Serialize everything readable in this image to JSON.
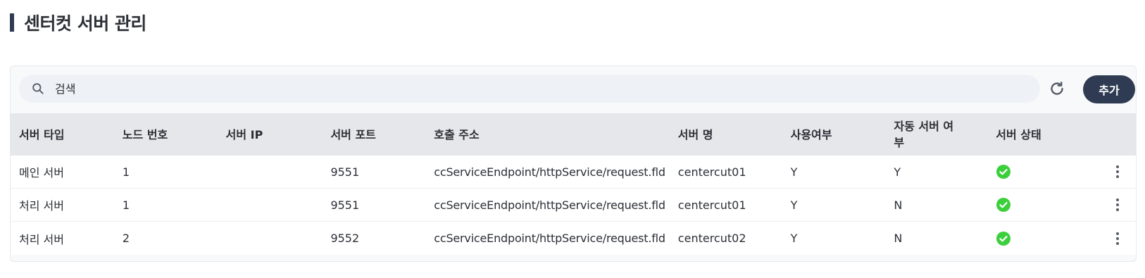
{
  "page": {
    "title": "센터컷 서버 관리"
  },
  "toolbar": {
    "search_placeholder": "검색",
    "search_value": "",
    "add_label": "추가",
    "refresh_icon": "refresh-icon",
    "search_icon": "search-icon"
  },
  "colors": {
    "title_bar": "#2f3b52",
    "add_button": "#2f3b52",
    "status_ok": "#3ccf3c",
    "header_bg": "#e6e7ea"
  },
  "table": {
    "headers": [
      "서버 타입",
      "노드 번호",
      "서버 IP",
      "서버 포트",
      "호출 주소",
      "서버 명",
      "사용여부",
      "자동 서버 여\n부",
      "서버 상태"
    ],
    "rows": [
      {
        "type": "메인 서버",
        "node": "1",
        "ip": "",
        "port": "9551",
        "endpoint": "ccServiceEndpoint/httpService/request.fld",
        "name": "centercut01",
        "use": "Y",
        "auto": "Y",
        "status": "ok"
      },
      {
        "type": "처리 서버",
        "node": "1",
        "ip": "",
        "port": "9551",
        "endpoint": "ccServiceEndpoint/httpService/request.fld",
        "name": "centercut01",
        "use": "Y",
        "auto": "N",
        "status": "ok"
      },
      {
        "type": "처리 서버",
        "node": "2",
        "ip": "",
        "port": "9552",
        "endpoint": "ccServiceEndpoint/httpService/request.fld",
        "name": "centercut02",
        "use": "Y",
        "auto": "N",
        "status": "ok"
      }
    ]
  }
}
